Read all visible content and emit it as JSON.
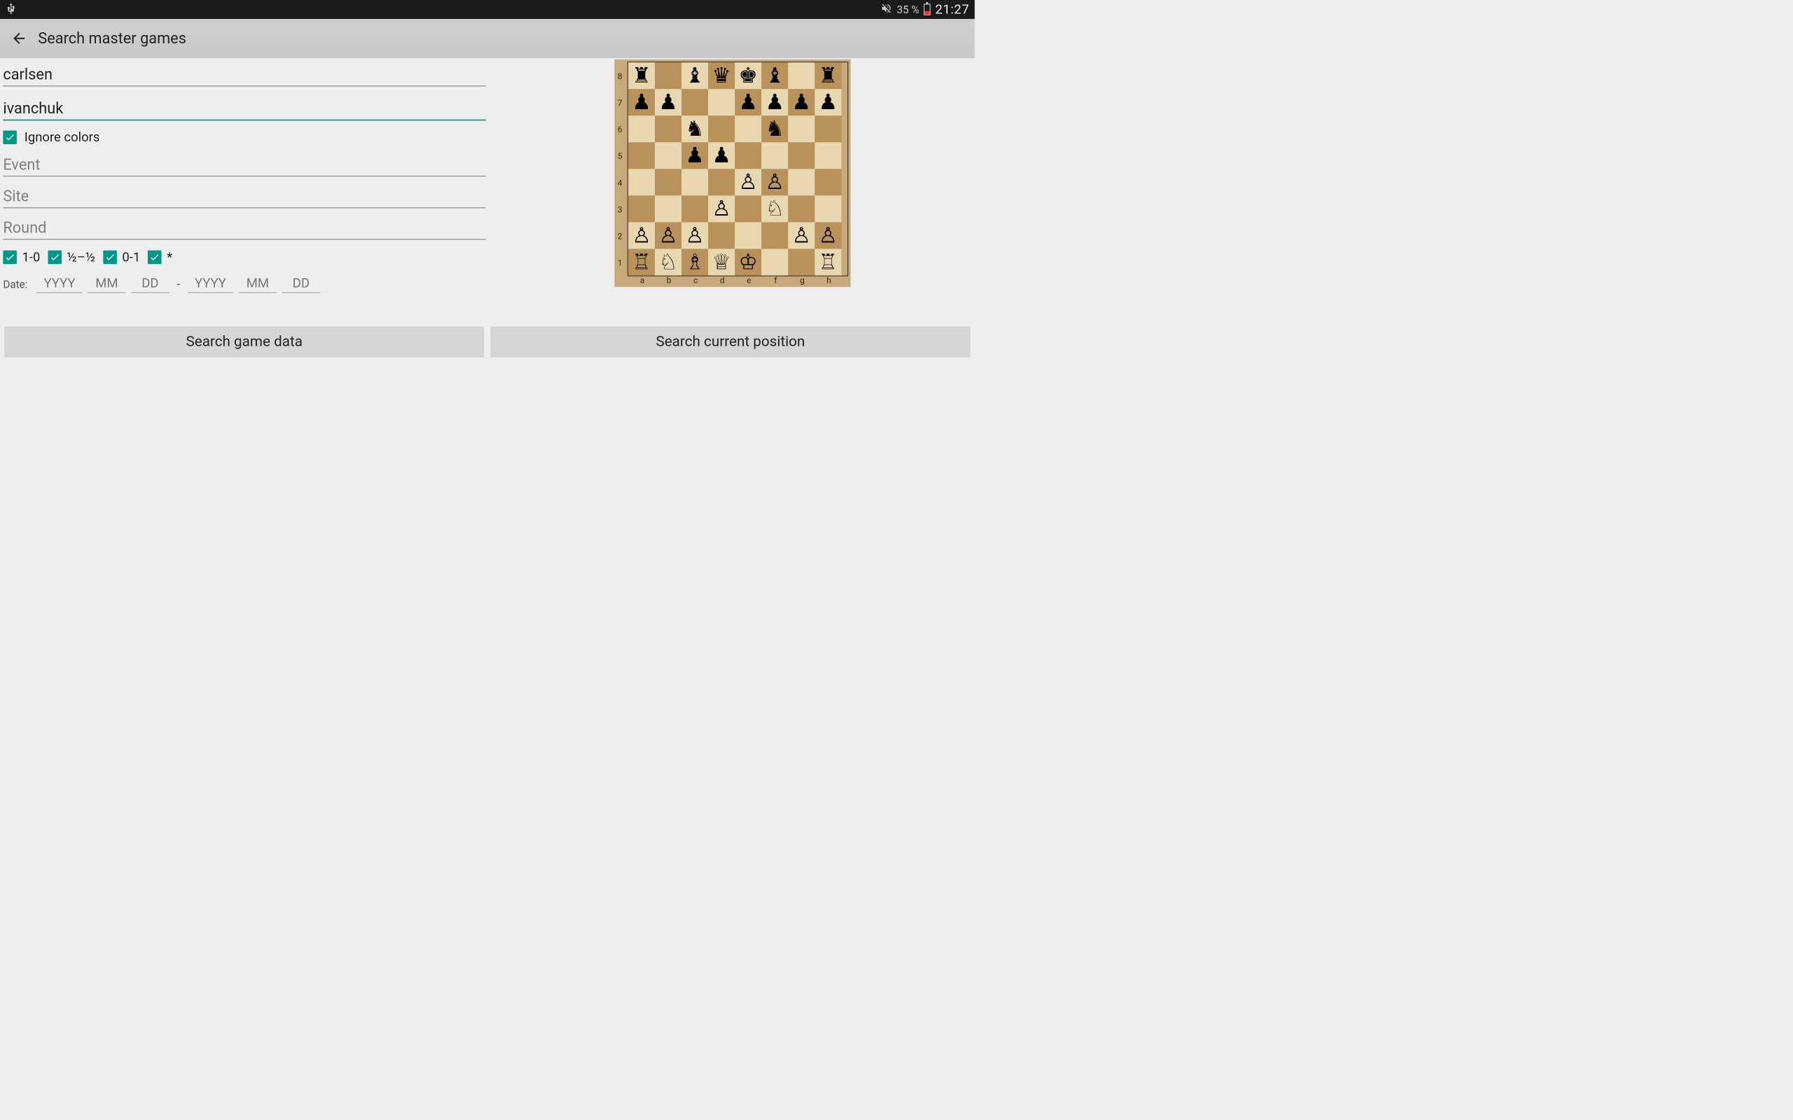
{
  "status_bar": {
    "battery_text": "35 %",
    "clock": "21:27"
  },
  "app_bar": {
    "title": "Search master games"
  },
  "form": {
    "white_player": "carlsen",
    "black_player": "ivanchuk",
    "ignore_colors_label": "Ignore colors",
    "event_placeholder": "Event",
    "site_placeholder": "Site",
    "round_placeholder": "Round",
    "results": {
      "r1": "1-0",
      "r2": "½–½",
      "r3": "0-1",
      "r4": "*"
    },
    "date_label": "Date:",
    "date_ph": {
      "y": "YYYY",
      "m": "MM",
      "d": "DD"
    }
  },
  "buttons": {
    "search_data": "Search game data",
    "search_position": "Search current position"
  },
  "board": {
    "ranks": [
      "8",
      "7",
      "6",
      "5",
      "4",
      "3",
      "2",
      "1"
    ],
    "files": [
      "a",
      "b",
      "c",
      "d",
      "e",
      "f",
      "g",
      "h"
    ],
    "pieces": {
      "a8": "br",
      "c8": "bb",
      "d8": "bq",
      "e8": "bk",
      "f8": "bb",
      "h8": "br",
      "a7": "bp",
      "b7": "bp",
      "e7": "bp",
      "f7": "bp",
      "g7": "bp",
      "h7": "bp",
      "c6": "bn",
      "f6": "bn",
      "c5": "bp",
      "d5": "bp",
      "e4": "wp",
      "f4": "wp",
      "d3": "wp",
      "f3": "wn",
      "a2": "wp",
      "b2": "wp",
      "c2": "wp",
      "g2": "wp",
      "h2": "wp",
      "a1": "wr",
      "b1": "wn",
      "c1": "wb",
      "d1": "wq",
      "e1": "wk",
      "h1": "wr"
    }
  }
}
